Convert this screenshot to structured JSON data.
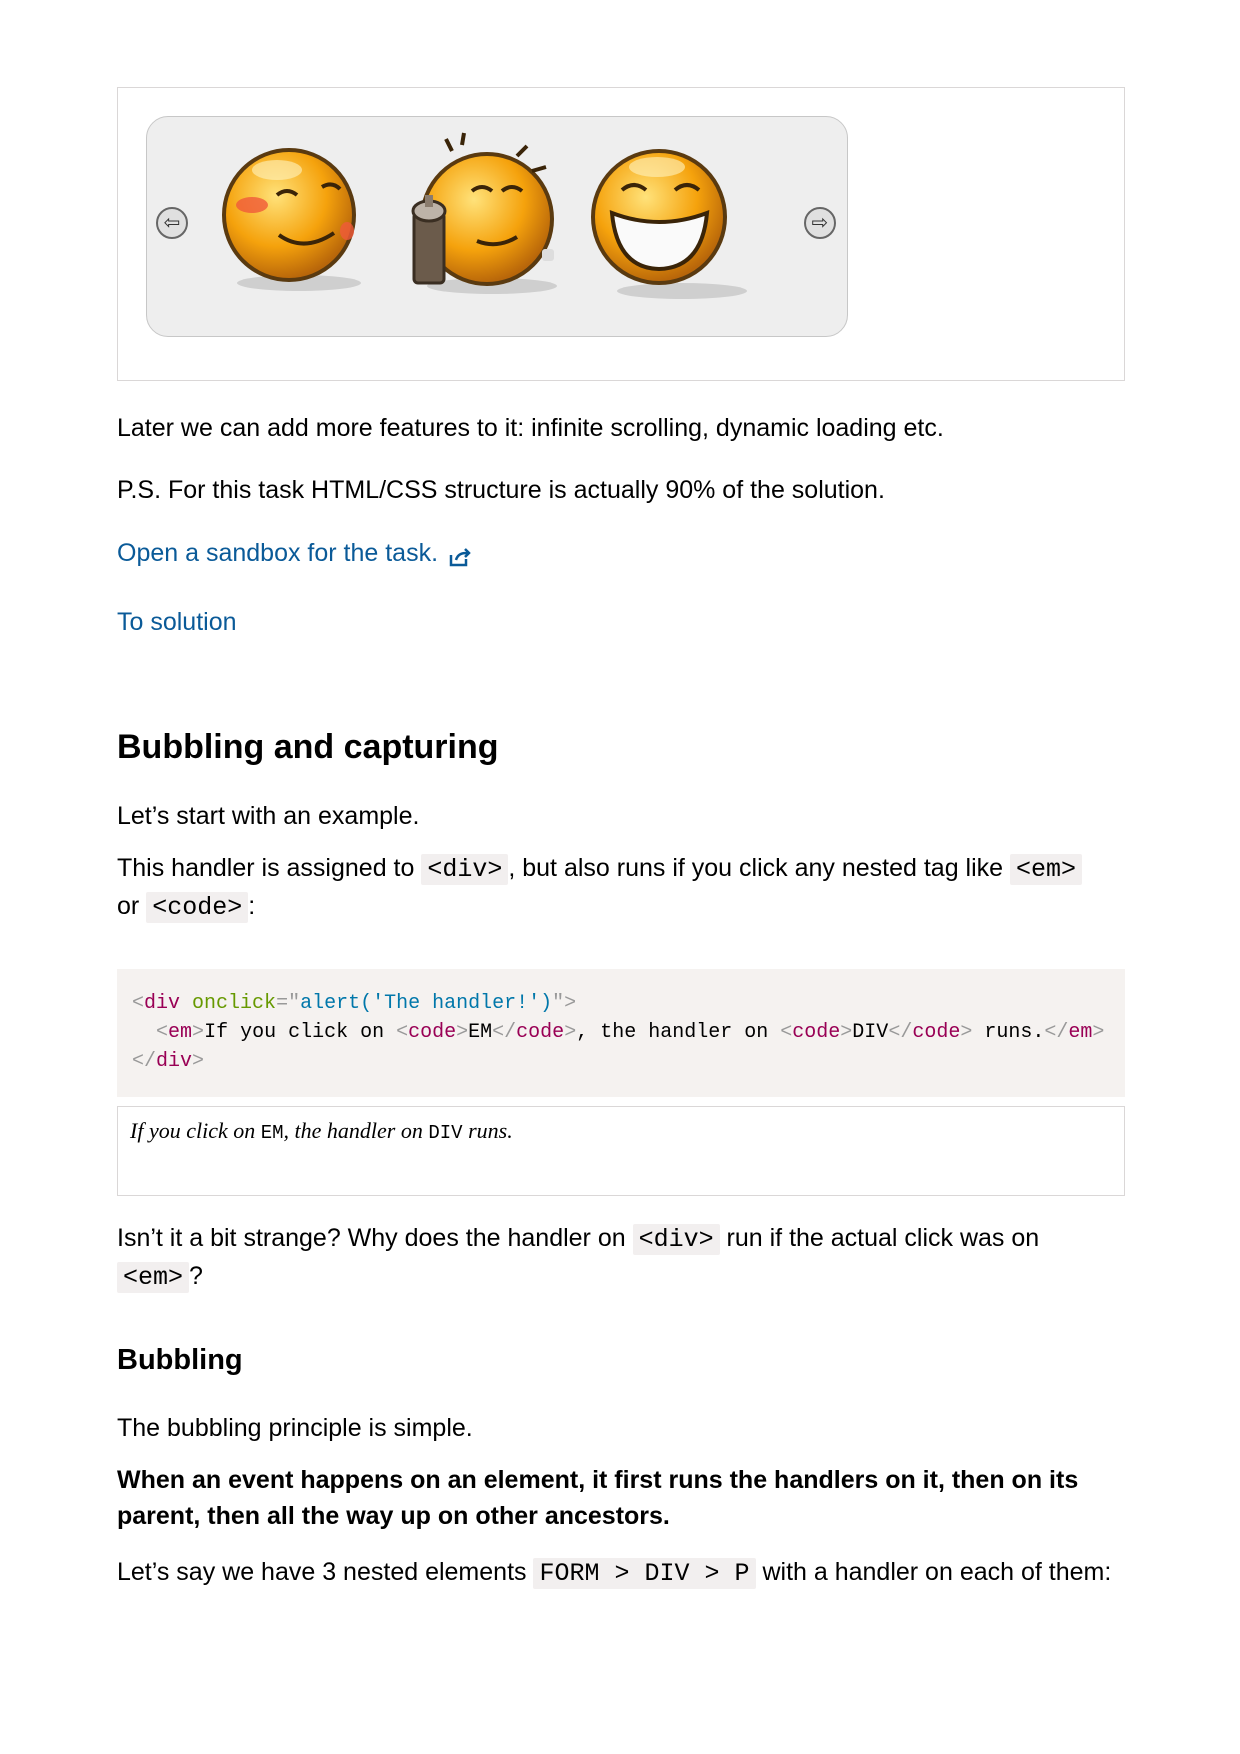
{
  "demo": {
    "left_arrow": "⇦",
    "right_arrow": "⇨",
    "smileys": [
      "blushing-smiley",
      "spray-smiley",
      "grinning-smiley"
    ]
  },
  "para_later": "Later we can add more features to it: infinite scrolling, dynamic loading etc.",
  "para_ps": "P.S. For this task HTML/CSS structure is actually 90% of the solution.",
  "link_sandbox": "Open a sandbox for the task.",
  "link_solution": "To solution",
  "heading_bubbling_capturing": "Bubbling and capturing",
  "para_start": "Let’s start with an example.",
  "para_handler": {
    "t1": "This handler is assigned to ",
    "c1": "<div>",
    "t2": ", but also runs if you click any nested tag like ",
    "c2": "<em>",
    "t3": " or ",
    "c3": "<code>",
    "t4": ":"
  },
  "code_example": {
    "line1": {
      "lt": "<",
      "tag": "div",
      "sp": " ",
      "attr": "onclick",
      "eq": "=",
      "q1": "\"",
      "val": "alert('The handler!')",
      "q2": "\"",
      "gt": ">"
    },
    "line2": {
      "indent": "  ",
      "em_open_lt": "<",
      "em_open": "em",
      "em_open_gt": ">",
      "text1": "If you click on ",
      "c1_lt": "<",
      "c1": "code",
      "c1_gt": ">",
      "t_em": "EM",
      "c1c_lt": "</",
      "c1c": "code",
      "c1c_gt": ">",
      "text2": ", the handler on ",
      "c2_lt": "<",
      "c2": "code",
      "c2_gt": ">",
      "t_div": "DIV",
      "c2c_lt": "</",
      "c2c": "code",
      "c2c_gt": ">",
      "text3": " runs.",
      "em_close_lt": "</",
      "em_close": "em",
      "em_close_gt": ">"
    },
    "line3": {
      "lt": "</",
      "tag": "div",
      "gt": ">"
    }
  },
  "result": {
    "t1": "If you click on ",
    "c1": "EM",
    "t2": ", the handler on ",
    "c2": "DIV",
    "t3": " runs."
  },
  "para_strange": {
    "t1": "Isn’t it a bit strange? Why does the handler on ",
    "c1": "<div>",
    "t2": " run if the actual click was on ",
    "c2": "<em>",
    "t3": "?"
  },
  "heading_bubbling": "Bubbling",
  "para_principle": "The bubbling principle is simple.",
  "para_bold": "When an event happens on an element, it first runs the handlers on it, then on its parent, then all the way up on other ancestors.",
  "para_nested": {
    "t1": "Let’s say we have 3 nested elements ",
    "c1": "FORM > DIV > P",
    "t2": " with a handler on each of them:"
  }
}
